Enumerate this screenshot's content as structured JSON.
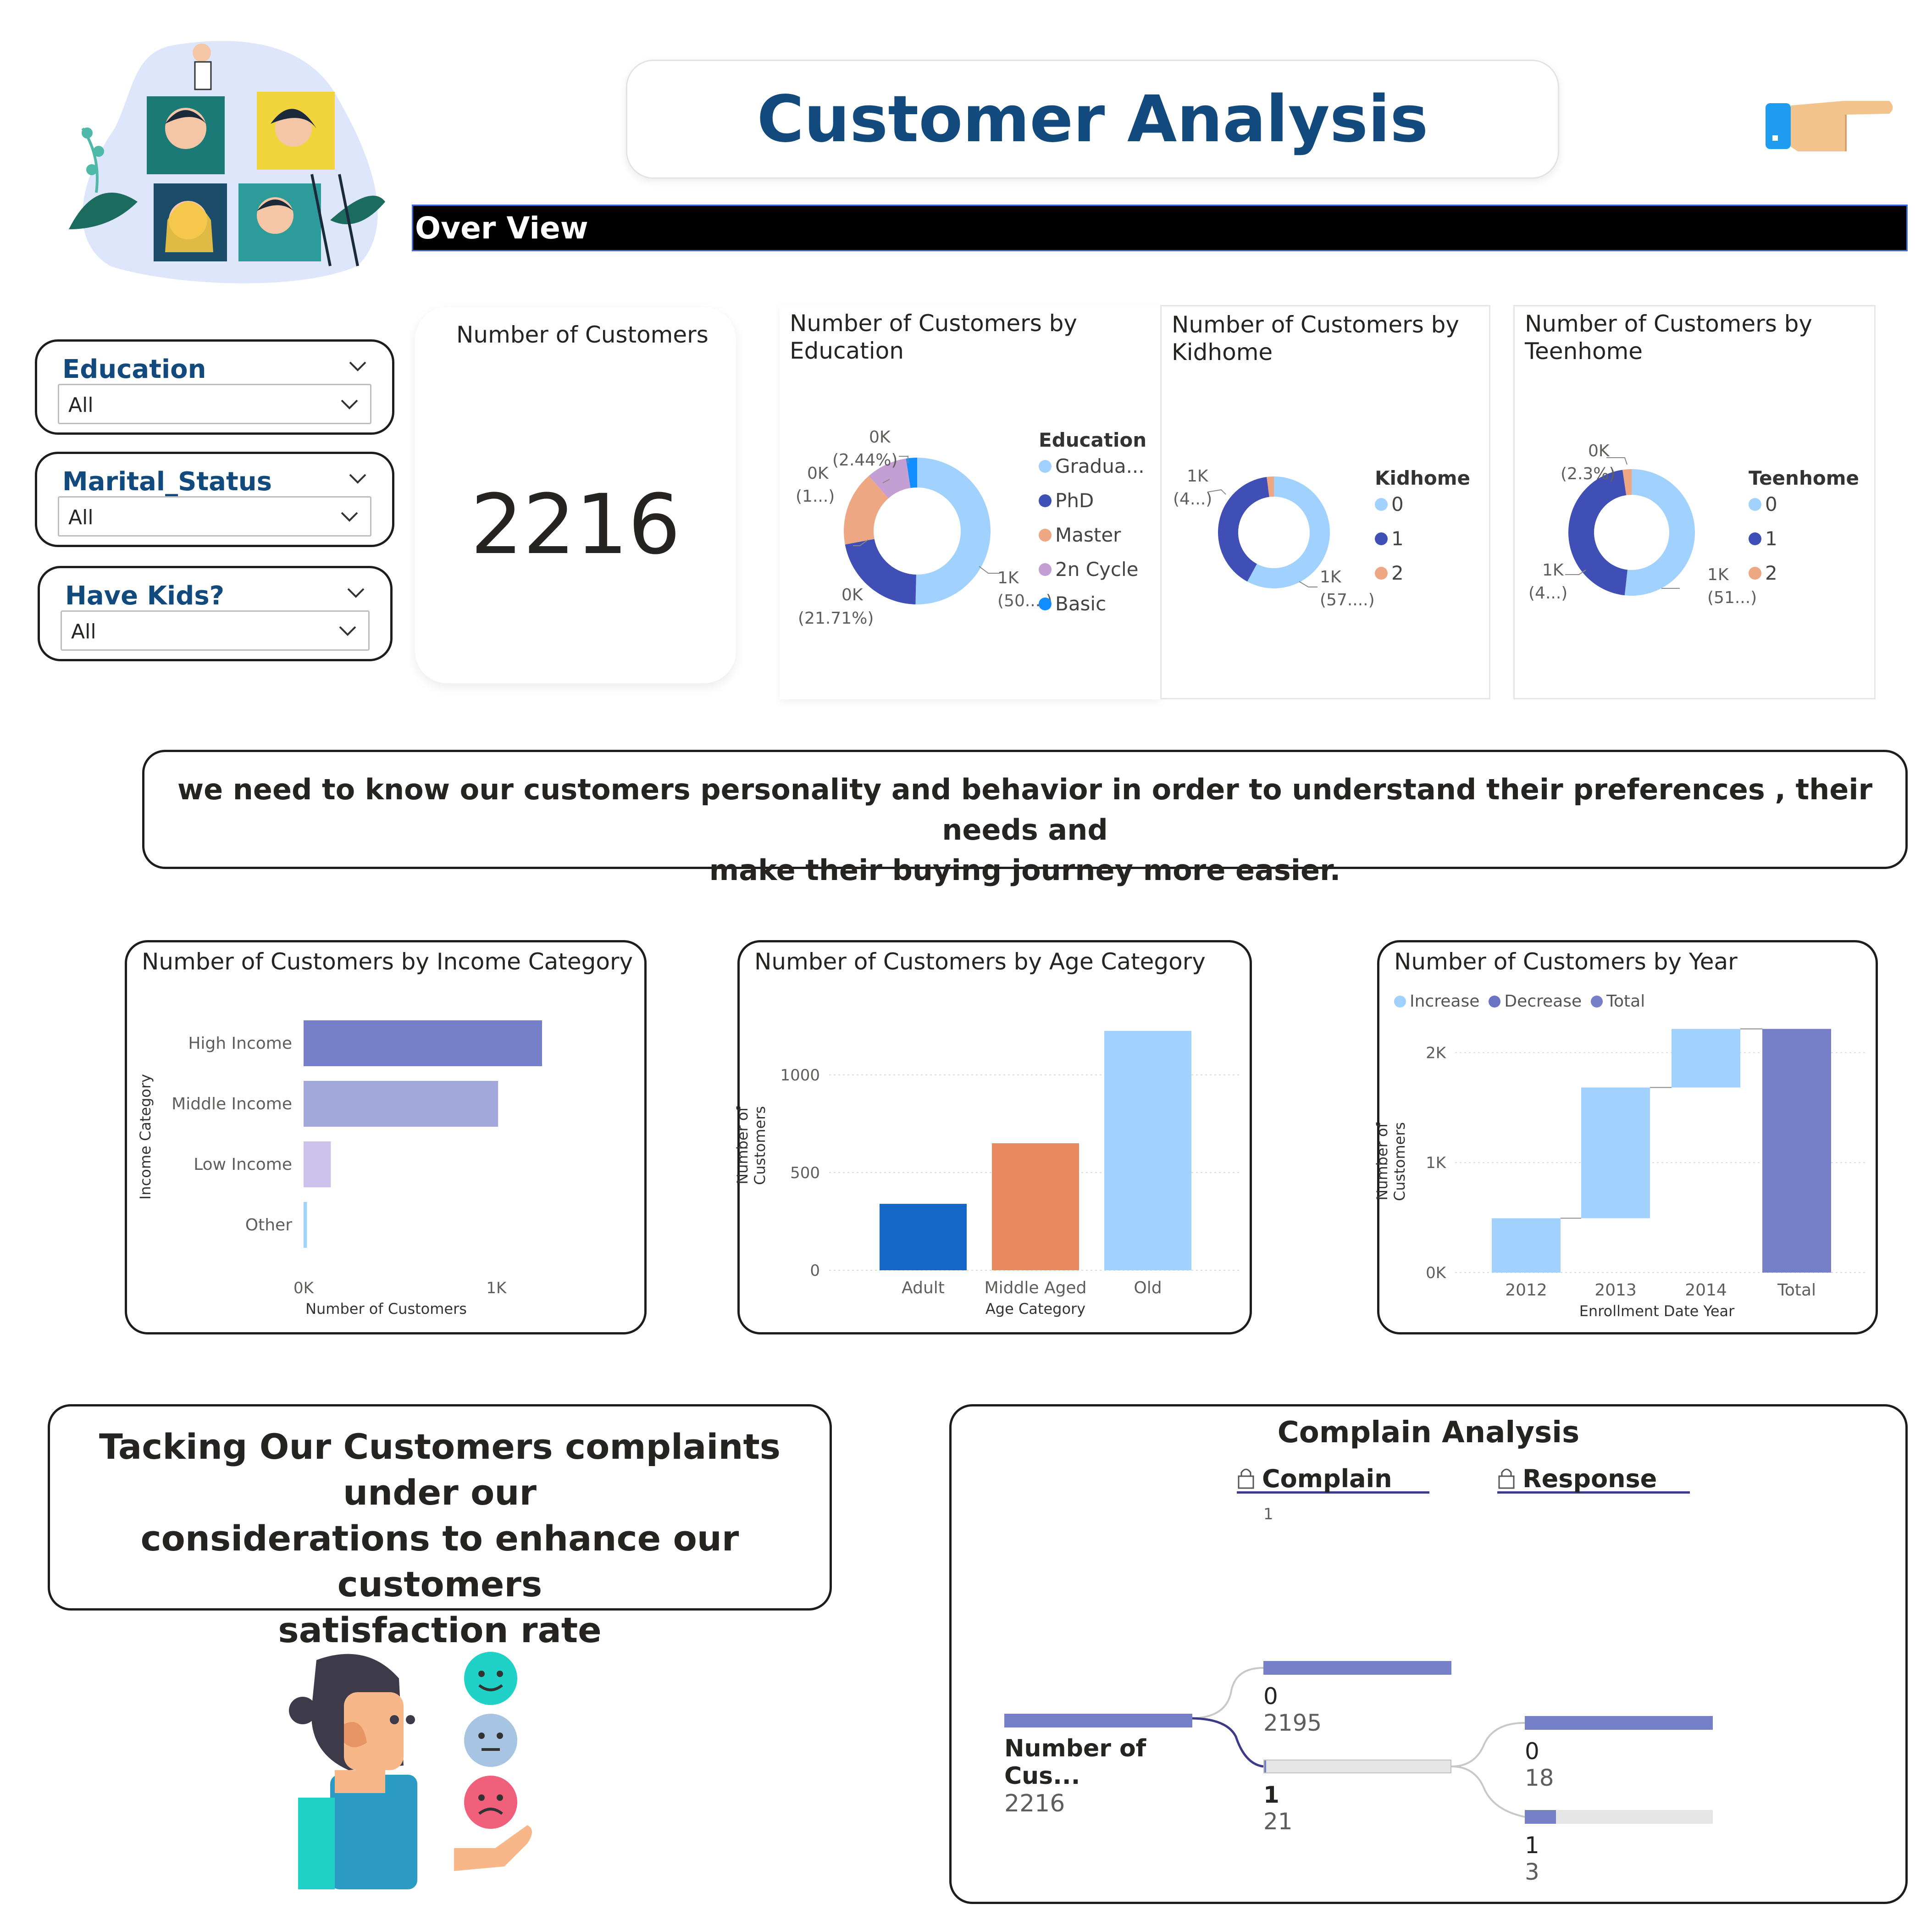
{
  "header": {
    "title": "Customer Analysis",
    "overview_label": "Over View"
  },
  "slicers": [
    {
      "title": "Education",
      "value": "All"
    },
    {
      "title": "Marital_Status",
      "value": "All"
    },
    {
      "title": "Have Kids?",
      "value": "All"
    }
  ],
  "kpi": {
    "title": "Number of Customers",
    "value": "2216"
  },
  "donut_education": {
    "title_line1": "Number of Customers by",
    "title_line2": "Education",
    "legend_title": "Education",
    "legend": [
      "Gradua...",
      "PhD",
      "Master",
      "2n Cycle",
      "Basic"
    ],
    "labels": {
      "top_k": "0K",
      "top_pct": "(2.44%)",
      "left_k": "0K",
      "left_pct": "(1...)",
      "bottom_k": "0K",
      "bottom_pct": "(21.71%)",
      "right_k": "1K",
      "right_pct": "(50....)"
    }
  },
  "donut_kidhome": {
    "title_line1": "Number of Customers by",
    "title_line2": "Kidhome",
    "legend_title": "Kidhome",
    "legend": [
      "0",
      "1",
      "2"
    ],
    "labels": {
      "left_k": "1K",
      "left_pct": "(4...)",
      "right_k": "1K",
      "right_pct": "(57....)"
    }
  },
  "donut_teenhome": {
    "title_line1": "Number of Customers by",
    "title_line2": "Teenhome",
    "legend_title": "Teenhome",
    "legend": [
      "0",
      "1",
      "2"
    ],
    "labels": {
      "top_k": "0K",
      "top_pct": "(2.3%)",
      "left_k": "1K",
      "left_pct": "(4...)",
      "right_k": "1K",
      "right_pct": "(51...)"
    }
  },
  "message1": {
    "line1": "we need to know our customers personality and behavior in order to understand their preferences , their needs and",
    "line2": "make their buying journey more easier."
  },
  "income_chart": {
    "title": "Number of Customers by Income Category",
    "ylabel": "Income Category",
    "xlabel": "Number of Customers",
    "ticks": [
      "0K",
      "1K"
    ]
  },
  "age_chart": {
    "title": "Number of Customers by Age Category",
    "ylabel": "Number of Customers",
    "xlabel": "Age Category",
    "ticks": [
      "0",
      "500",
      "1000"
    ]
  },
  "year_chart": {
    "title": "Number of Customers by Year",
    "legend": [
      "Increase",
      "Decrease",
      "Total"
    ],
    "ylabel": "Number of Customers",
    "xlabel": "Enrollment Date Year",
    "ticks": [
      "0K",
      "1K",
      "2K"
    ]
  },
  "message2": {
    "line1": "Tacking Our Customers complaints under our",
    "line2": "considerations to enhance our customers",
    "line3": "satisfaction rate"
  },
  "complain": {
    "title": "Complain Analysis",
    "col1": "Complain",
    "col1_sub": "1",
    "col2": "Response",
    "root_label": "Number of Cus...",
    "root_value": "2216",
    "c0_label": "0",
    "c0_value": "2195",
    "c1_label": "1",
    "c1_value": "21",
    "r0_label": "0",
    "r0_value": "18",
    "r1_label": "1",
    "r1_value": "3"
  },
  "colors": {
    "title": "#124a7d",
    "light_blue": "#a0d1ff",
    "dark_blue": "#3f4fb5",
    "orange": "#e8895f",
    "light_orange": "#eda783",
    "purple": "#c39fd4",
    "bright_blue": "#118dff",
    "lavender": "#7580c8",
    "lavender_light": "#a3a8da",
    "lilac": "#cbc1ea",
    "dark_bar": "#1467c6",
    "grey_bar": "#e6e6e6"
  },
  "chart_data": [
    {
      "type": "pie",
      "title": "Number of Customers by Education",
      "categories": [
        "Graduation",
        "PhD",
        "Master",
        "2n Cycle",
        "Basic"
      ],
      "values": [
        1116,
        481,
        365,
        200,
        54
      ],
      "percent": [
        50.4,
        21.71,
        16.5,
        9.0,
        2.44
      ]
    },
    {
      "type": "pie",
      "title": "Number of Customers by Kidhome",
      "categories": [
        "0",
        "1",
        "2"
      ],
      "values": [
        1283,
        887,
        46
      ]
    },
    {
      "type": "pie",
      "title": "Number of Customers by Teenhome",
      "categories": [
        "0",
        "1",
        "2"
      ],
      "values": [
        1147,
        1018,
        51
      ]
    },
    {
      "type": "bar",
      "orientation": "horizontal",
      "title": "Number of Customers by Income Category",
      "categories": [
        "High Income",
        "Middle Income",
        "Low Income",
        "Other"
      ],
      "values": [
        1140,
        930,
        130,
        16
      ],
      "xlim": [
        0,
        1300
      ],
      "xlabel": "Number of Customers",
      "ylabel": "Income Category"
    },
    {
      "type": "bar",
      "title": "Number of Customers by Age Category",
      "categories": [
        "Adult",
        "Middle Aged",
        "Old"
      ],
      "values": [
        340,
        650,
        1225
      ],
      "ylim": [
        0,
        1250
      ],
      "xlabel": "Age Category",
      "ylabel": "Number of Customers"
    },
    {
      "type": "bar",
      "subtype": "waterfall",
      "title": "Number of Customers by Year",
      "categories": [
        "2012",
        "2013",
        "2014",
        "Total"
      ],
      "values": [
        494,
        1189,
        533,
        2216
      ],
      "ylim": [
        0,
        2400
      ],
      "xlabel": "Enrollment Date Year",
      "ylabel": "Number of Customers"
    }
  ]
}
